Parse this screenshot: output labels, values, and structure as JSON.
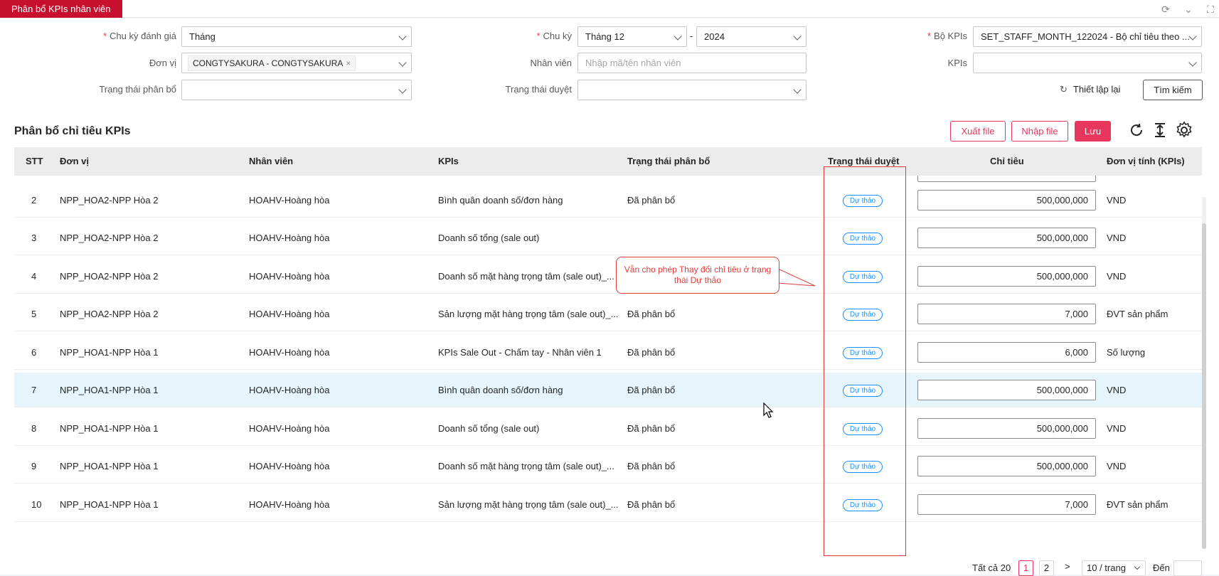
{
  "tab": {
    "title": "Phân bổ KPIs nhân viên"
  },
  "filters": {
    "cycle_label": "Chu kỳ đánh giá",
    "cycle_value": "Tháng",
    "period_label": "Chu kỳ",
    "period_month": "Tháng 12",
    "period_sep": "-",
    "period_year": "2024",
    "kpiset_label": "Bộ KPIs",
    "kpiset_value": "SET_STAFF_MONTH_122024 - Bộ chỉ tiêu theo ...",
    "unit_label": "Đơn vị",
    "unit_tag": "CONGTYSAKURA - CONGTYSAKURA",
    "unit_tag_remove": "×",
    "staff_label": "Nhân viên",
    "staff_placeholder": "Nhập mã/tên nhân viên",
    "kpis_label": "KPIs",
    "alloc_status_label": "Trạng thái phân bổ",
    "approve_status_label": "Trạng thái duyệt",
    "reset_label": "Thiết lập lại",
    "search_label": "Tìm kiếm"
  },
  "section": {
    "title": "Phân bổ chỉ tiêu KPIs",
    "export_label": "Xuất file",
    "import_label": "Nhập file",
    "save_label": "Lưu"
  },
  "table": {
    "headers": [
      "STT",
      "Đơn vị",
      "Nhân viên",
      "KPIs",
      "Trạng thái phân bổ",
      "Trạng thái duyệt",
      "Chỉ tiêu",
      "Đơn vị tính (KPIs)"
    ],
    "rows": [
      {
        "stt": "2",
        "unit": "NPP_HOA2-NPP Hòa 2",
        "staff": "HOAHV-Hoàng hòa",
        "kpi": "Bình quân doanh số/đơn hàng",
        "alloc": "Đã phân bổ",
        "approve": "Dự thảo",
        "target": "500,000,000",
        "uom": "VND"
      },
      {
        "stt": "3",
        "unit": "NPP_HOA2-NPP Hòa 2",
        "staff": "HOAHV-Hoàng hòa",
        "kpi": "Doanh số tổng (sale out)",
        "alloc": "",
        "approve": "Dự thảo",
        "target": "500,000,000",
        "uom": "VND"
      },
      {
        "stt": "4",
        "unit": "NPP_HOA2-NPP Hòa 2",
        "staff": "HOAHV-Hoàng hòa",
        "kpi": "Doanh số mặt hàng trọng tâm (sale out)_...",
        "alloc": "Đã phân bổ",
        "approve": "Dự thảo",
        "target": "500,000,000",
        "uom": "VND"
      },
      {
        "stt": "5",
        "unit": "NPP_HOA2-NPP Hòa 2",
        "staff": "HOAHV-Hoàng hòa",
        "kpi": "Sản lượng mặt hàng trọng tâm (sale out)_...",
        "alloc": "Đã phân bổ",
        "approve": "Dự thảo",
        "target": "7,000",
        "uom": "ĐVT sản phẩm"
      },
      {
        "stt": "6",
        "unit": "NPP_HOA1-NPP Hòa 1",
        "staff": "HOAHV-Hoàng hòa",
        "kpi": "KPIs Sale Out - Chấm tay - Nhân viên 1",
        "alloc": "Đã phân bổ",
        "approve": "Dự thảo",
        "target": "6,000",
        "uom": "Số lượng"
      },
      {
        "stt": "7",
        "unit": "NPP_HOA1-NPP Hòa 1",
        "staff": "HOAHV-Hoàng hòa",
        "kpi": "Bình quân doanh số/đơn hàng",
        "alloc": "Đã phân bổ",
        "approve": "Dự thảo",
        "target": "500,000,000",
        "uom": "VND"
      },
      {
        "stt": "8",
        "unit": "NPP_HOA1-NPP Hòa 1",
        "staff": "HOAHV-Hoàng hòa",
        "kpi": "Doanh số tổng (sale out)",
        "alloc": "Đã phân bổ",
        "approve": "Dự thảo",
        "target": "500,000,000",
        "uom": "VND"
      },
      {
        "stt": "9",
        "unit": "NPP_HOA1-NPP Hòa 1",
        "staff": "HOAHV-Hoàng hòa",
        "kpi": "Doanh số mặt hàng trọng tâm (sale out)_...",
        "alloc": "Đã phân bổ",
        "approve": "Dự thảo",
        "target": "500,000,000",
        "uom": "VND"
      },
      {
        "stt": "10",
        "unit": "NPP_HOA1-NPP Hòa 1",
        "staff": "HOAHV-Hoàng hòa",
        "kpi": "Sản lượng mặt hàng trọng tâm (sale out)_...",
        "alloc": "Đã phân bổ",
        "approve": "Dự thảo",
        "target": "7,000",
        "uom": "ĐVT sản phẩm"
      }
    ]
  },
  "annotation": {
    "callout_text": "Vẫn cho phép Thay đổi chỉ tiêu ở trạng thái Dự thảo"
  },
  "pagination": {
    "total_text": "Tất cả 20",
    "pages": [
      "1",
      "2"
    ],
    "next": ">",
    "page_size": "10 / trang",
    "goto_label": "Đến"
  },
  "colors": {
    "brand": "#c8102e",
    "accent": "#e8365d",
    "badge": "#1890ff",
    "annotation": "#e03c3c"
  }
}
